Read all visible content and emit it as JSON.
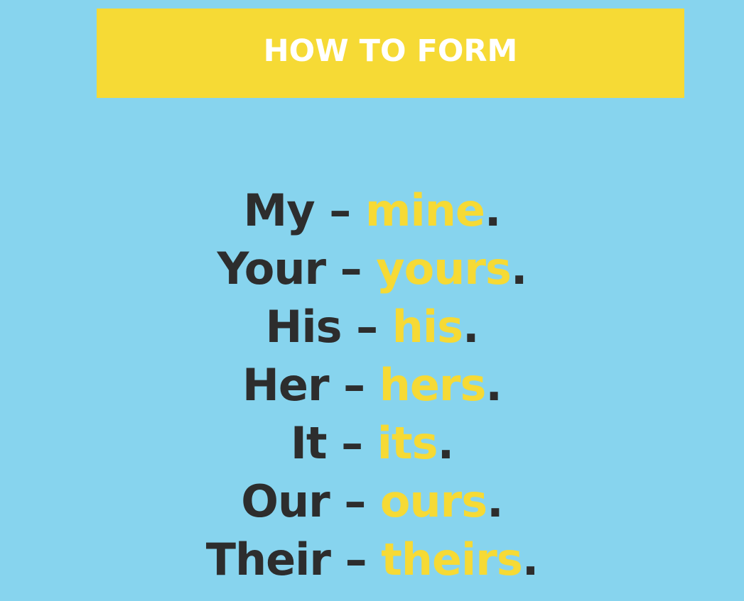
{
  "banner": {
    "title": "HOW TO FORM",
    "background_color": "#f6da35",
    "text_color": "#ffffff"
  },
  "page": {
    "background_color": "#87d4ee"
  },
  "colors": {
    "term": "#2d2d2d",
    "answer": "#f6da35"
  },
  "rows": [
    {
      "term": "My",
      "dash": "–",
      "answer": "mine",
      "dot": "."
    },
    {
      "term": "Your",
      "dash": "–",
      "answer": "yours",
      "dot": "."
    },
    {
      "term": "His",
      "dash": "–",
      "answer": "his",
      "dot": "."
    },
    {
      "term": "Her",
      "dash": "–",
      "answer": "hers",
      "dot": "."
    },
    {
      "term": "It",
      "dash": "–",
      "answer": "its",
      "dot": "."
    },
    {
      "term": "Our",
      "dash": "–",
      "answer": "ours",
      "dot": "."
    },
    {
      "term": "Their",
      "dash": "–",
      "answer": "theirs",
      "dot": "."
    }
  ]
}
